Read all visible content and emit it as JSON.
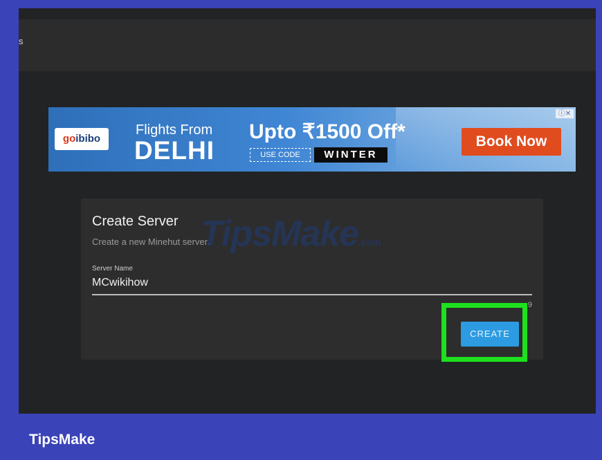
{
  "topbar": {
    "char": "s"
  },
  "ad": {
    "logo_go": "go",
    "logo_rest": "ibibo",
    "flights_from": "Flights From",
    "city": "DELHI",
    "offer": "Upto ₹1500 Off*",
    "use_code_label": "USE CODE",
    "code": "WINTER",
    "cta": "Book Now",
    "ad_choices": "ⓘ✕"
  },
  "create_server": {
    "title": "Create Server",
    "subtitle": "Create a new Minehut server.",
    "field_label": "Server Name",
    "field_value": "MCwikihow",
    "char_count": "9",
    "create_button": "CREATE"
  },
  "watermark": {
    "text": "TipsMake",
    "suffix": ".com"
  },
  "footer": {
    "brand": "TipsMake"
  },
  "colors": {
    "frame": "#3a43b8",
    "highlight": "#1ee01e",
    "button": "#2d9be2"
  }
}
